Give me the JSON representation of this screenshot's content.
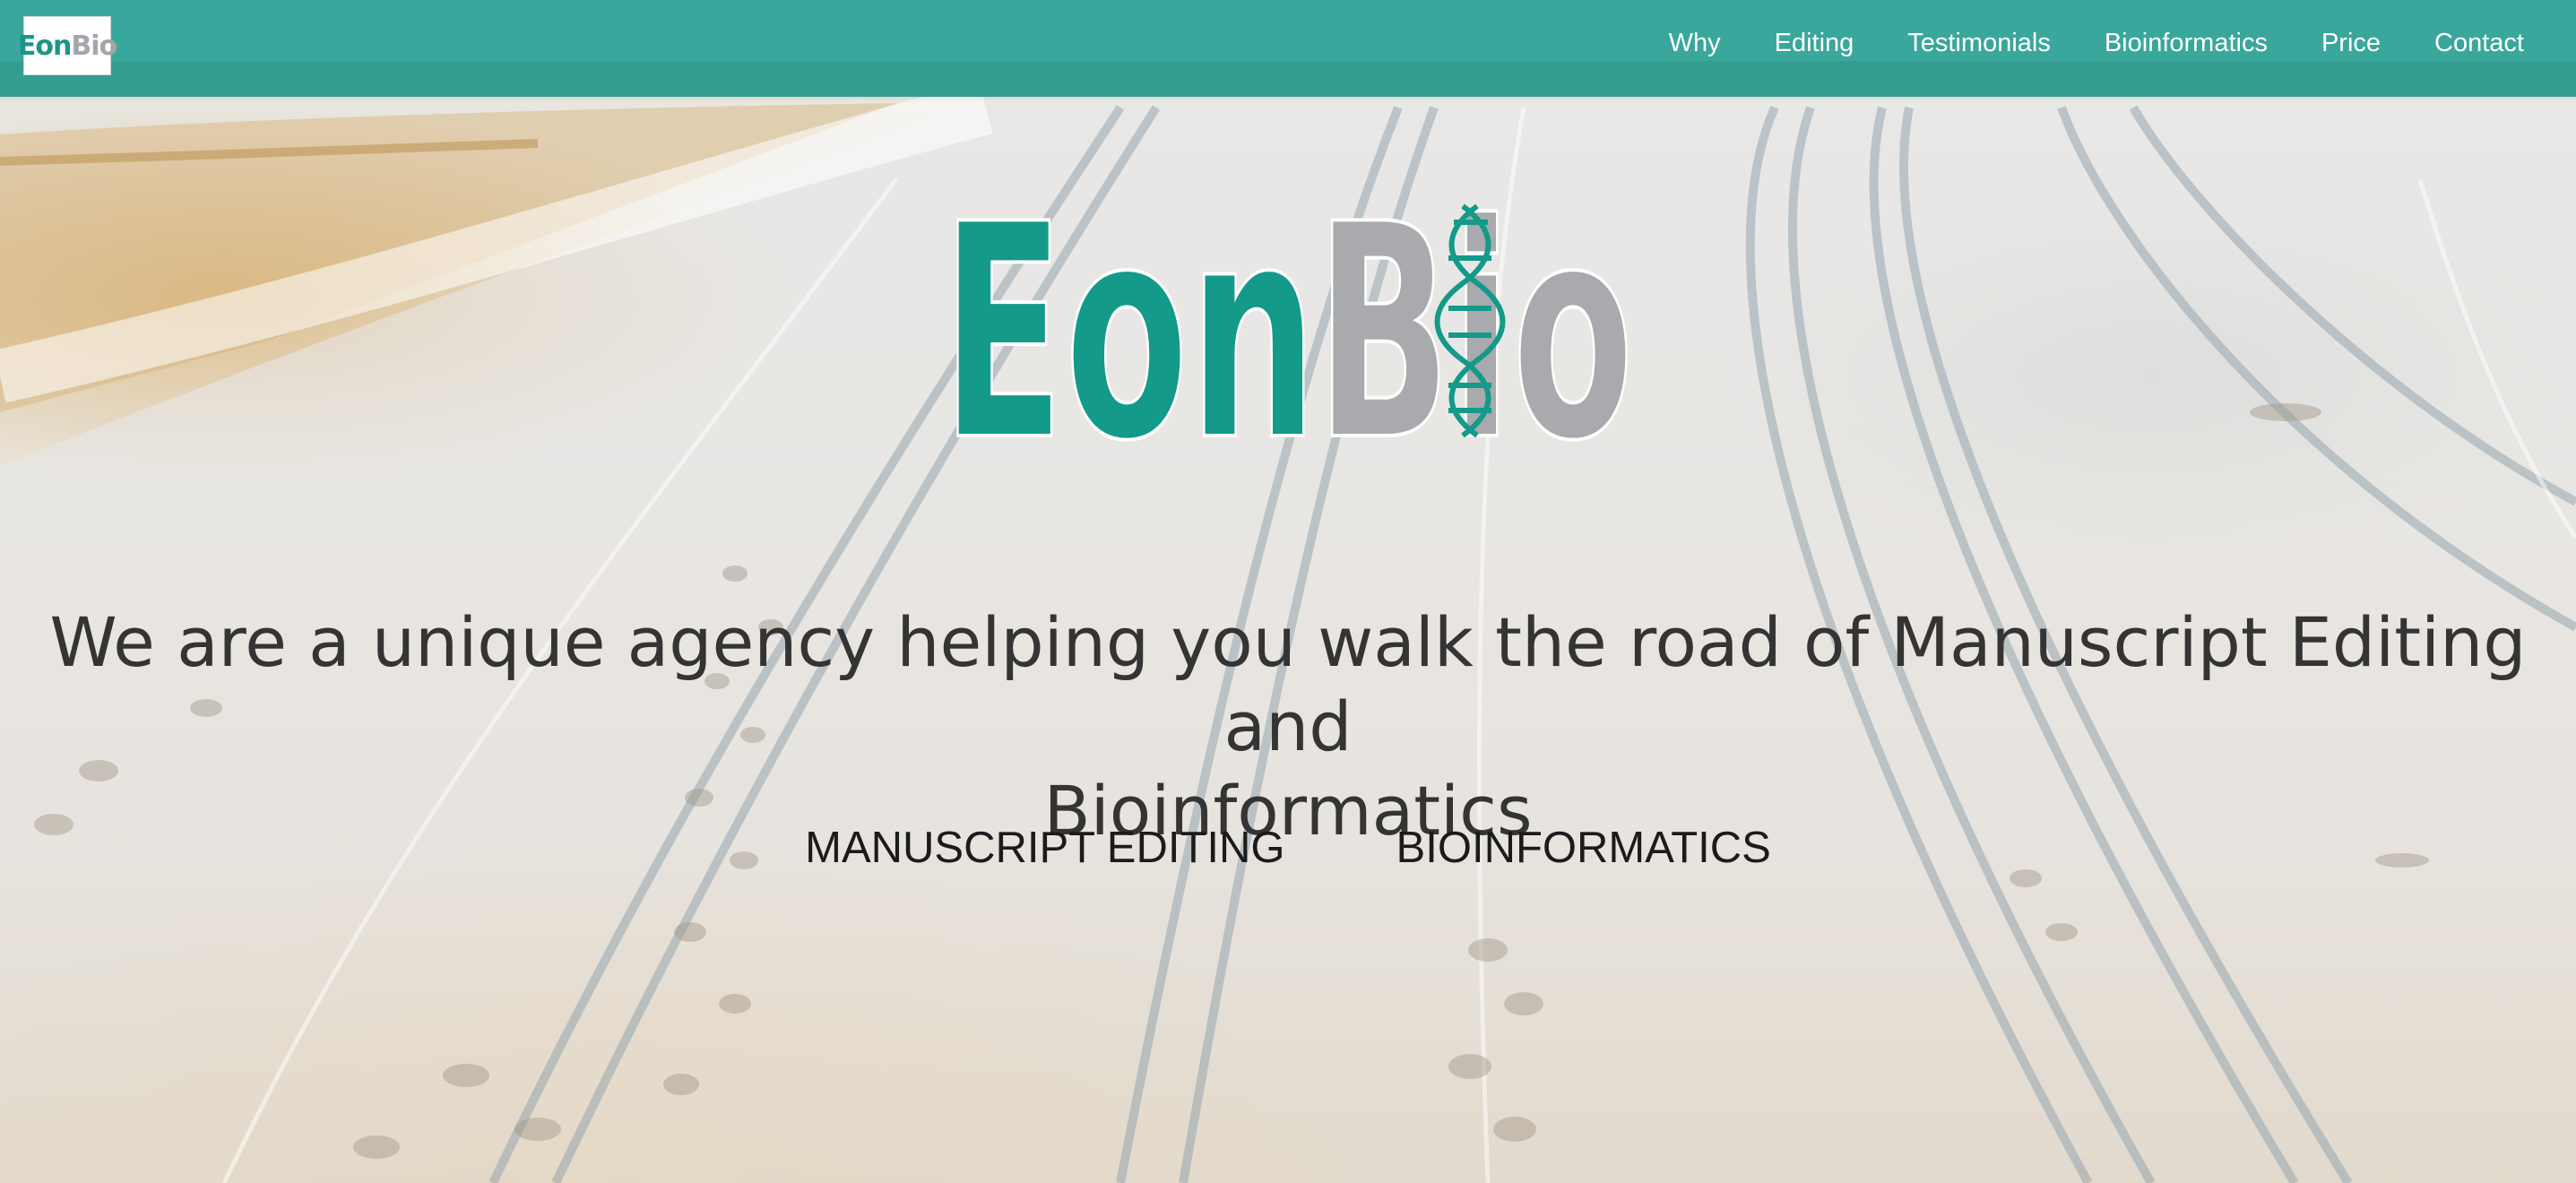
{
  "brand": {
    "name_part1": "Eon",
    "name_part2": "Bio",
    "primary_color": "#1a9688",
    "secondary_color": "#a3a6aa"
  },
  "nav": {
    "background": "#3aa79c",
    "items": [
      {
        "label": "Why"
      },
      {
        "label": "Editing"
      },
      {
        "label": "Testimonials"
      },
      {
        "label": "Bioinformatics"
      },
      {
        "label": "Price"
      },
      {
        "label": "Contact"
      }
    ]
  },
  "hero": {
    "logo_part1": "Eon",
    "logo_part2": "Bio",
    "logo_icon": "dna-helix-icon",
    "headline_line1": "We are a unique agency helping you walk the road of Manuscript Editing and",
    "headline_line2": "Bioinformatics",
    "cta_primary": "MANUSCRIPT EDITING",
    "cta_secondary": "BIOINFORMATICS",
    "background_icon": "sand-road-photo"
  }
}
